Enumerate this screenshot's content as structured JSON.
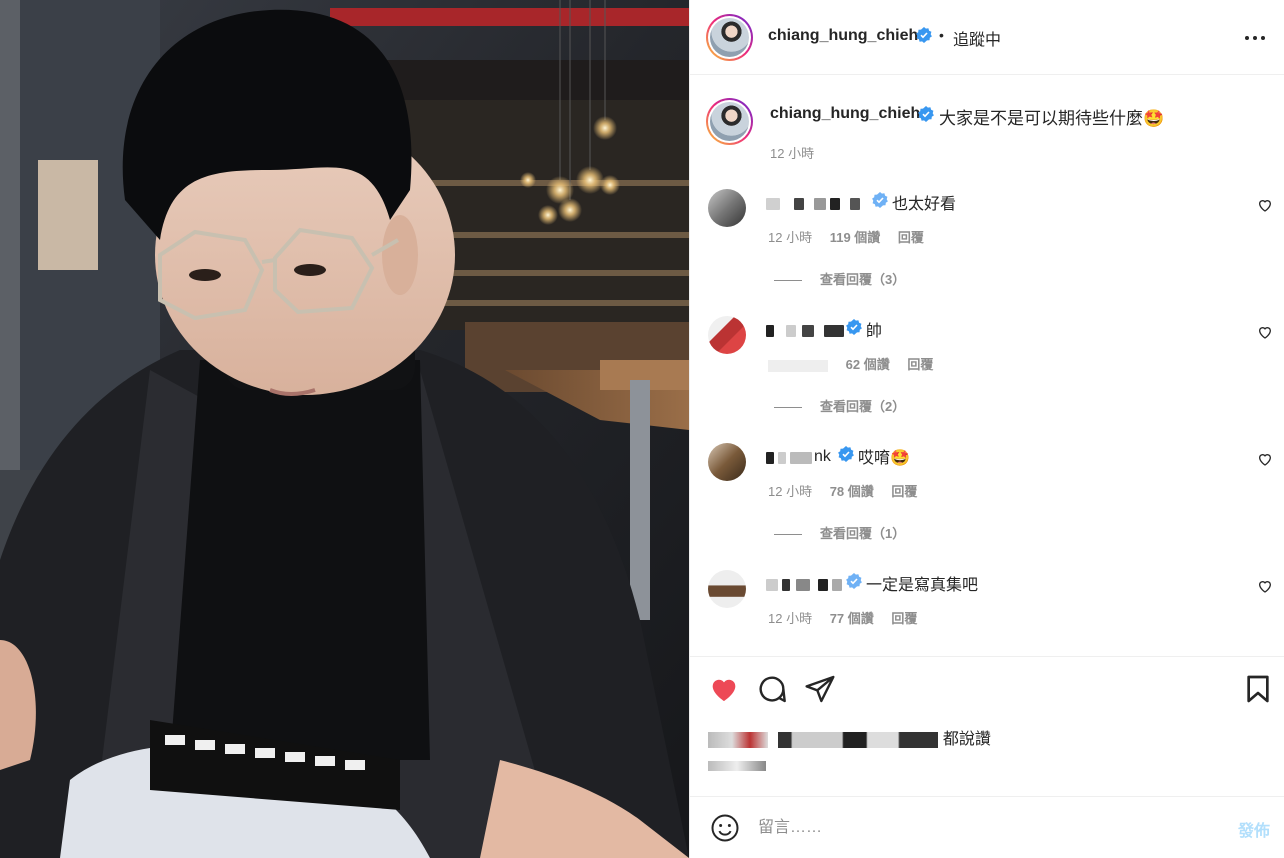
{
  "post": {
    "author": "chiang_hung_chieh",
    "follow_separator": "•",
    "follow_status": "追蹤中",
    "caption": "大家是不是可以期待些什麼🤩",
    "caption_time": "12 小時"
  },
  "comments": [
    {
      "visible_name_suffix": "",
      "text": "也太好看",
      "time": "12 小時",
      "likes": "119 個讚",
      "reply": "回覆",
      "view_replies": "查看回覆（3）"
    },
    {
      "visible_name_suffix": "",
      "text": "帥",
      "time": "",
      "likes": "62 個讚",
      "reply": "回覆",
      "view_replies": "查看回覆（2）"
    },
    {
      "visible_name_suffix": "nk",
      "text": "哎唷🤩",
      "time": "12 小時",
      "likes": "78 個讚",
      "reply": "回覆",
      "view_replies": "查看回覆（1）"
    },
    {
      "visible_name_suffix": "",
      "text": "一定是寫真集吧",
      "time": "12 小時",
      "likes": "77 個讚",
      "reply": "回覆",
      "view_replies": ""
    }
  ],
  "likes_summary": "都說讚",
  "post_date": "",
  "comment_input": {
    "placeholder": "留言……",
    "post_label": "發佈"
  },
  "colors": {
    "heart_liked": "#ed4956",
    "verified": "#3897f0",
    "post_button_disabled": "#b2dffc"
  },
  "icons": [
    "more-icon",
    "heart-icon",
    "comment-icon",
    "share-icon",
    "bookmark-icon",
    "emoji-icon",
    "verified-icon"
  ]
}
